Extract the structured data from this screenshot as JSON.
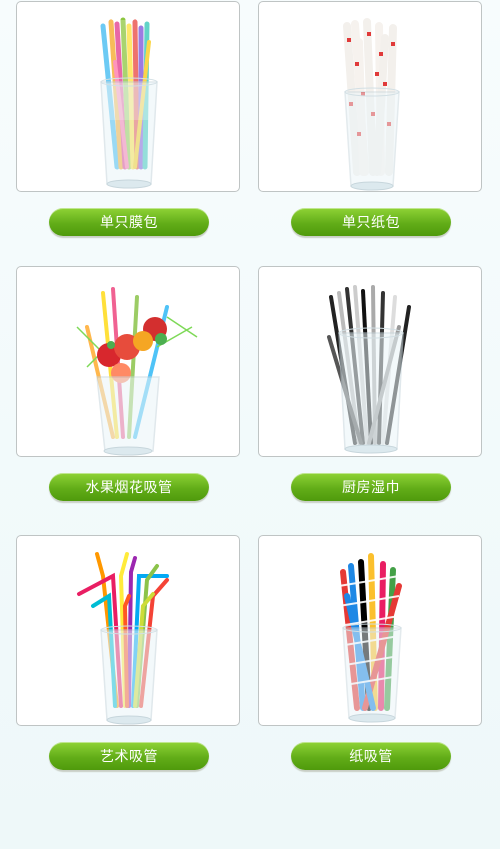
{
  "products": [
    {
      "label": "单只膜包",
      "icon": "straws-in-film-wrap-glass"
    },
    {
      "label": "单只纸包",
      "icon": "paper-wrapped-straws-glass"
    },
    {
      "label": "水果烟花吸管",
      "icon": "fruit-firework-straws-glass"
    },
    {
      "label": "厨房湿巾",
      "icon": "striped-straws-glass"
    },
    {
      "label": "艺术吸管",
      "icon": "art-bendy-straws-glass"
    },
    {
      "label": "纸吸管",
      "icon": "paper-straws-glass"
    }
  ],
  "colors": {
    "button_green": "#62ad18",
    "card_border": "#bfc4c4",
    "background": "#f2fafb"
  }
}
